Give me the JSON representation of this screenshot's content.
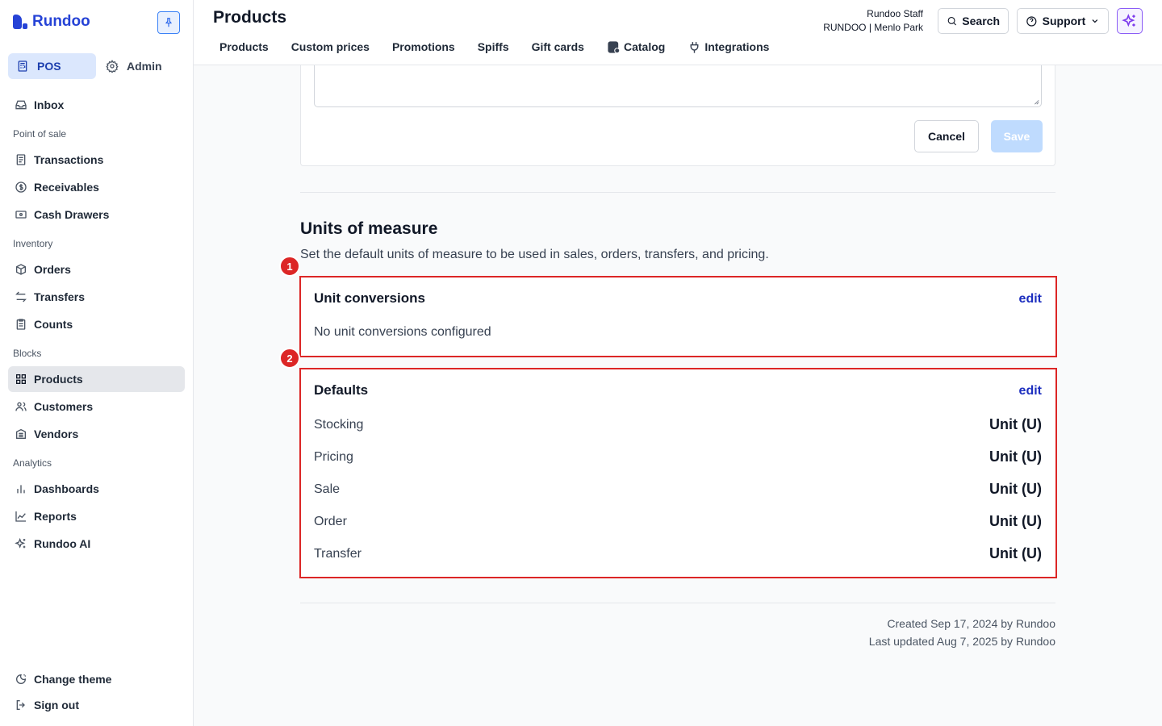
{
  "sidebar": {
    "brand": "Rundoo",
    "modes": {
      "pos": "POS",
      "admin": "Admin"
    },
    "inbox": "Inbox",
    "sections": {
      "point_of_sale": "Point of sale",
      "inventory": "Inventory",
      "blocks": "Blocks",
      "analytics": "Analytics"
    },
    "items": {
      "transactions": "Transactions",
      "receivables": "Receivables",
      "cash_drawers": "Cash Drawers",
      "orders": "Orders",
      "transfers": "Transfers",
      "counts": "Counts",
      "products": "Products",
      "customers": "Customers",
      "vendors": "Vendors",
      "dashboards": "Dashboards",
      "reports": "Reports",
      "rundoo_ai": "Rundoo AI"
    },
    "footer": {
      "change_theme": "Change theme",
      "sign_out": "Sign out"
    }
  },
  "header": {
    "title": "Products",
    "tabs": [
      "Products",
      "Custom prices",
      "Promotions",
      "Spiffs",
      "Gift cards",
      "Catalog",
      "Integrations"
    ],
    "user_name": "Rundoo Staff",
    "store": "RUNDOO | Menlo Park",
    "search_label": "Search",
    "support_label": "Support"
  },
  "form": {
    "cancel_label": "Cancel",
    "save_label": "Save"
  },
  "units": {
    "title": "Units of measure",
    "description": "Set the default units of measure to be used in sales, orders, transfers, and pricing.",
    "conversions": {
      "marker": "1",
      "title": "Unit conversions",
      "edit_label": "edit",
      "empty_text": "No unit conversions configured"
    },
    "defaults": {
      "marker": "2",
      "title": "Defaults",
      "edit_label": "edit",
      "rows": [
        {
          "label": "Stocking",
          "value": "Unit (U)"
        },
        {
          "label": "Pricing",
          "value": "Unit (U)"
        },
        {
          "label": "Sale",
          "value": "Unit (U)"
        },
        {
          "label": "Order",
          "value": "Unit (U)"
        },
        {
          "label": "Transfer",
          "value": "Unit (U)"
        }
      ]
    }
  },
  "meta": {
    "created": "Created Sep 17, 2024 by Rundoo",
    "updated": "Last updated Aug 7, 2025 by Rundoo"
  },
  "colors": {
    "brand": "#2643d6",
    "highlight_border": "#dc2626",
    "link": "#1d2fbf",
    "save_disabled": "#bfdbfe",
    "ai_accent": "#8b5cf6"
  }
}
